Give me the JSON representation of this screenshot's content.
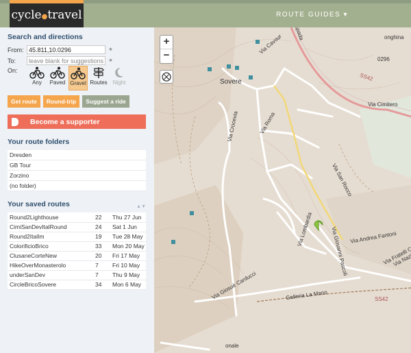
{
  "header": {
    "logo_left": "cycle",
    "logo_dot": "●",
    "logo_right": "travel",
    "nav_route_guides": "ROUTE GUIDES ▾"
  },
  "search": {
    "title": "Search and directions",
    "from_label": "From:",
    "from_value": "45.811,10.0296",
    "to_label": "To:",
    "to_placeholder": "leave blank for suggestions",
    "on_label": "On:",
    "modes": [
      {
        "label": "Any",
        "icon": "bike-icon"
      },
      {
        "label": "Paved",
        "icon": "road-bike-icon"
      },
      {
        "label": "Gravel",
        "icon": "gravel-bike-icon"
      },
      {
        "label": "Routes",
        "icon": "signpost-icon"
      },
      {
        "label": "Night",
        "icon": "moon-icon"
      }
    ],
    "get_route": "Get route",
    "round_trip": "Round-trip",
    "suggest_ride": "Suggest a ride"
  },
  "supporter": {
    "label": "Become a supporter"
  },
  "folders": {
    "title": "Your route folders",
    "items": [
      "Dresden",
      "GB Tour",
      "Zorzino",
      "(no folder)"
    ]
  },
  "saved": {
    "title": "Your saved routes",
    "sort_glyphs": "▲▼",
    "rows": [
      {
        "name": "Round2Lighthouse",
        "km": "22",
        "date": "Thu 27 Jun"
      },
      {
        "name": "CimiSanDevItalRound",
        "km": "24",
        "date": "Sat 1 Jun"
      },
      {
        "name": "Round2ItalIm",
        "km": "19",
        "date": "Tue 28 May"
      },
      {
        "name": "ColorificioBrico",
        "km": "33",
        "date": "Mon 20 May"
      },
      {
        "name": "ClusaneCorteNew",
        "km": "20",
        "date": "Fri 17 May"
      },
      {
        "name": "HikeOverMonasterolo",
        "km": "7",
        "date": "Fri 10 May"
      },
      {
        "name": "underSanDev",
        "km": "7",
        "date": "Thu 9 May"
      },
      {
        "name": "CircleBricoSovere",
        "km": "34",
        "date": "Mon 6 May"
      }
    ]
  },
  "map": {
    "zoom_in": "+",
    "zoom_out": "−",
    "locate_glyph": "⨂",
    "labels": {
      "sovere": "Sovere",
      "via_roma": "Via Roma",
      "via_cavour": "Via Cavour",
      "via_crocevia": "Via Crocevia",
      "via_san_rocco": "Via San Rocco",
      "via_lombardia": "Via Lombardia",
      "via_giovanni_pascoli": "Via Giovanni Pascoli",
      "via_andrea_fantoni": "Via Andrea Fantoni",
      "via_fratelli_calvi": "Via Fratelli Calvi",
      "via_nazionale": "Via Nazio",
      "via_giosue_carducci": "Via Giosuè Carducci",
      "galleria_la_mano": "Galleria La Mano",
      "sp_53": "SS42",
      "sp_53b": "SS42",
      "via_cimitero": "Via Cimitero",
      "bonghina": "onghina",
      "r_0296": "0296",
      "spada": "Spada",
      "onale": "onale"
    }
  }
}
